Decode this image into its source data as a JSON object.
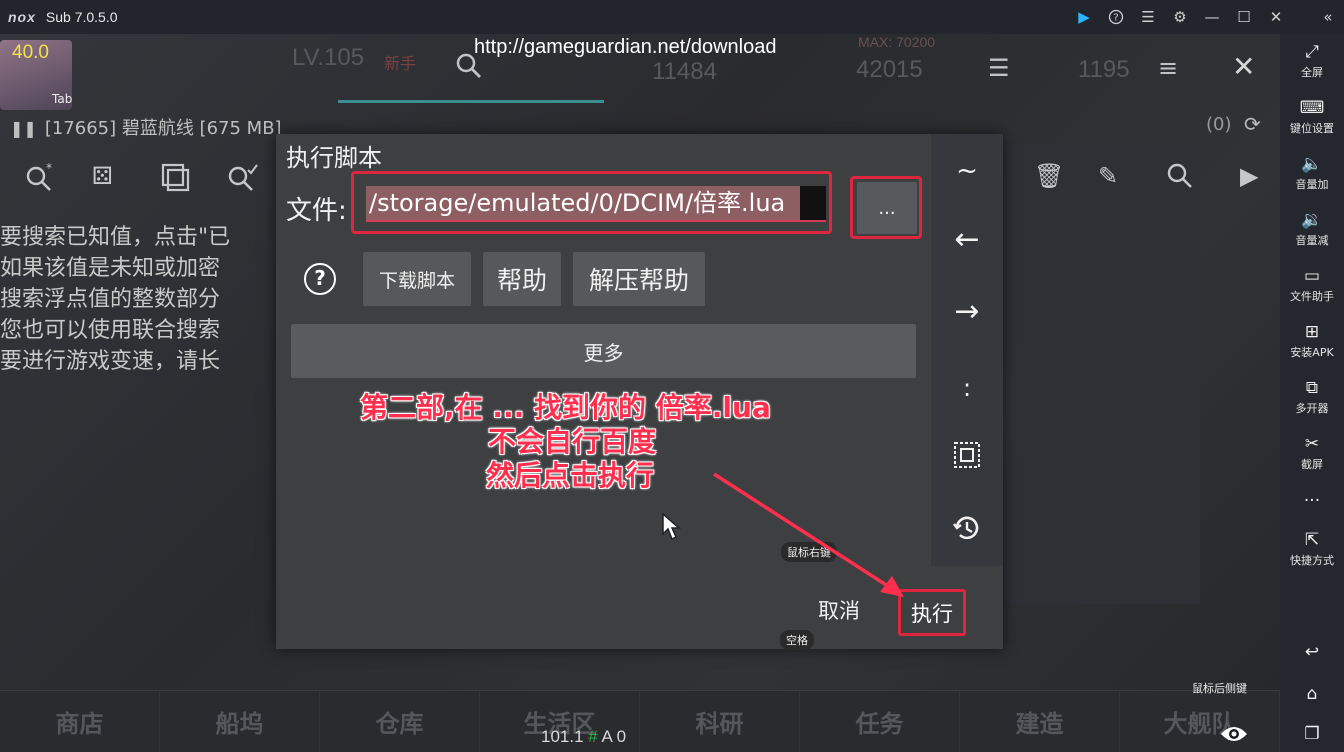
{
  "titlebar": {
    "logo": "nox",
    "version": "Sub 7.0.5.0"
  },
  "sidebar": {
    "items": [
      {
        "icon": "fullscreen-icon",
        "label": "全屏"
      },
      {
        "icon": "keyboard-icon",
        "label": "键位设置"
      },
      {
        "icon": "volume-up-icon",
        "label": "音量加"
      },
      {
        "icon": "volume-down-icon",
        "label": "音量减"
      },
      {
        "icon": "file-assistant-icon",
        "label": "文件助手"
      },
      {
        "icon": "install-apk-icon",
        "label": "安装APK"
      },
      {
        "icon": "multi-instance-icon",
        "label": "多开器"
      },
      {
        "icon": "scissors-icon",
        "label": "截屏"
      },
      {
        "icon": "more-icon",
        "label": "..."
      },
      {
        "icon": "shortcut-icon",
        "label": "快捷方式"
      }
    ]
  },
  "game_overlay": {
    "fps": "40.0",
    "tab_label": "Tab",
    "url": "http://gameguardian.net/download",
    "process": "[17665] 碧蓝航线 [675 MB]",
    "result_count": "(0)",
    "hint_lines": [
      "要搜索已知值，点击\"已",
      "如果该值是未知或加密",
      "搜索浮点值的整数部分",
      "您也可以使用联合搜索",
      "要进行游戏变速，请长"
    ],
    "status_value": "101.1",
    "status_hash": "#",
    "status_tail": "A 0",
    "back_key_hint": "鼠标后侧键",
    "dim_texts": {
      "level": "LV.105",
      "badge": "新手",
      "num1": "11484",
      "max": "MAX: 70200",
      "num2": "42015",
      "num3": "1195"
    },
    "bottom_nav": [
      "商店",
      "船坞",
      "仓库",
      "生活区",
      "科研",
      "任务",
      "建造",
      "大舰队"
    ]
  },
  "dialog": {
    "title": "执行脚本",
    "file_label": "文件:",
    "path_value": "/storage/emulated/0/DCIM/倍率.lua",
    "browse_label": "...",
    "help_symbol": "?",
    "download_button": "下载脚本",
    "help_button": "帮助",
    "unzip_help_button": "解压帮助",
    "more_button": "更多",
    "side_keys": [
      "~",
      "←",
      "→",
      ":",
      "⊡",
      "history"
    ],
    "cancel_button": "取消",
    "execute_button": "执行",
    "right_click_hint": "鼠标右键",
    "space_hint": "空格"
  },
  "annotation": {
    "line1": "第二部,在 ... 找到你的 倍率.lua",
    "line2": "不会自行百度",
    "line3": "然后点击执行",
    "color": "#ff2f4d"
  }
}
